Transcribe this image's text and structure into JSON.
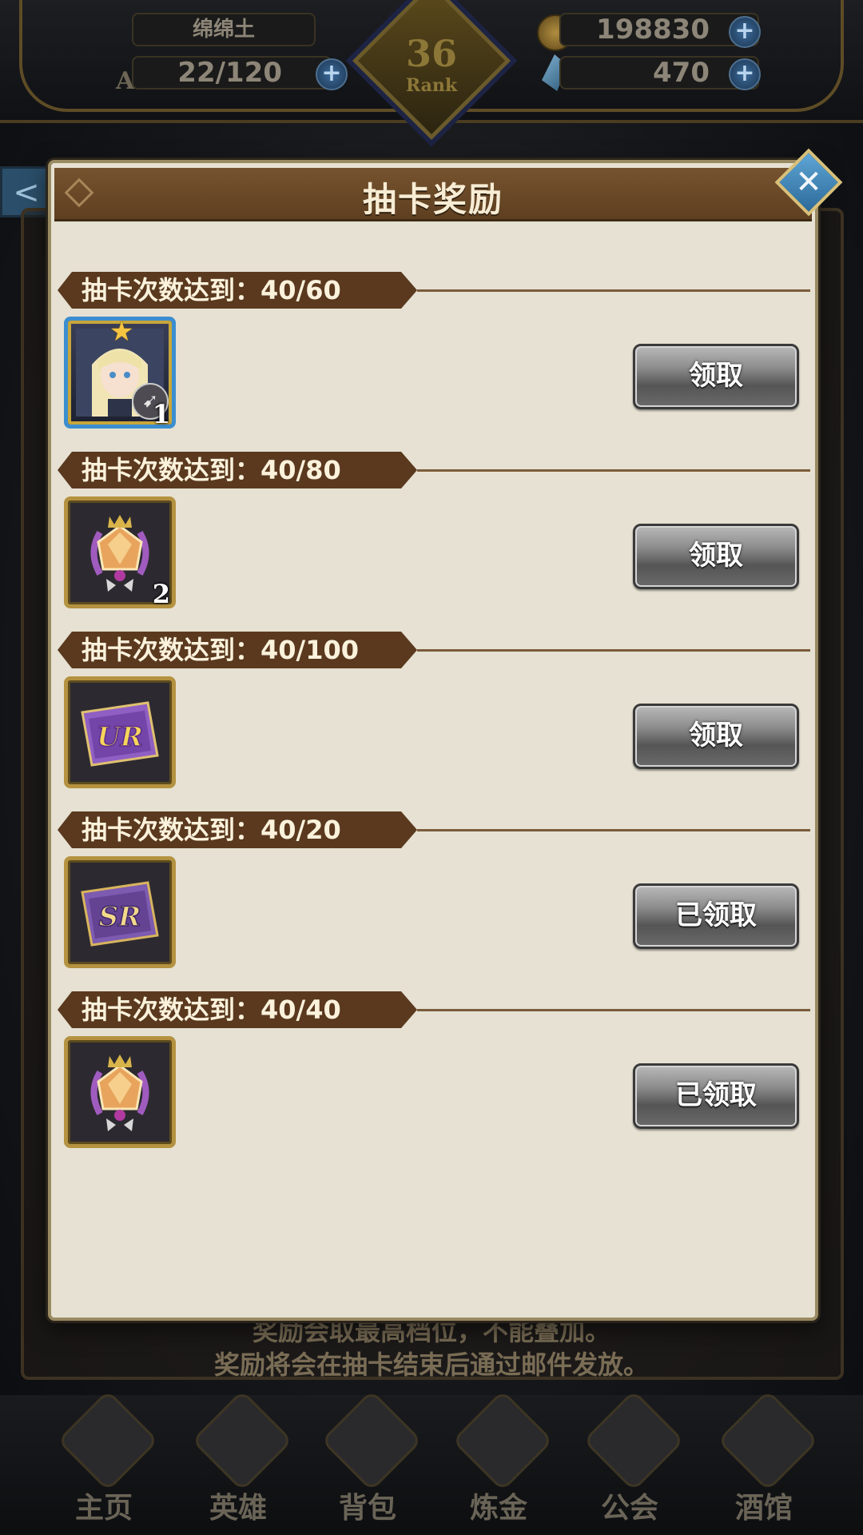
{
  "hud": {
    "player_name": "绵绵土",
    "ap_label": "AP",
    "ap": "22/120",
    "gold": "198830",
    "gems": "470",
    "rank": "36",
    "rank_label": "Rank"
  },
  "background": {
    "back_arrow": "<",
    "note_line1": "奖励会取最高档位，不能叠加。",
    "note_line2": "奖励将会在抽卡结束后通过邮件发放。"
  },
  "modal": {
    "title": "抽卡奖励",
    "rewards": [
      {
        "label": "抽卡次数达到：40/60",
        "item": "hero-card-elf-archer-icon",
        "count": "1",
        "button": "领取"
      },
      {
        "label": "抽卡次数达到：40/80",
        "item": "crown-crystal-emblem-icon",
        "count": "2",
        "button": "领取"
      },
      {
        "label": "抽卡次数达到：40/100",
        "item": "ur-ticket-icon",
        "ticket_text": "UR",
        "count": "",
        "button": "领取"
      },
      {
        "label": "抽卡次数达到：40/20",
        "item": "sr-ticket-icon",
        "ticket_text": "SR",
        "count": "",
        "button": "已领取"
      },
      {
        "label": "抽卡次数达到：40/40",
        "item": "crown-crystal-emblem-icon",
        "count": "",
        "button": "已领取"
      }
    ]
  },
  "nav": {
    "items": [
      "主页",
      "英雄",
      "背包",
      "炼金",
      "公会",
      "酒馆"
    ]
  },
  "colors": {
    "modal_bg": "#e6e1d2",
    "header_brown": "#5e3f20",
    "banner_brown": "#5a391f",
    "frame_gold": "#b59240",
    "button_gray": "#8d8d8d"
  }
}
